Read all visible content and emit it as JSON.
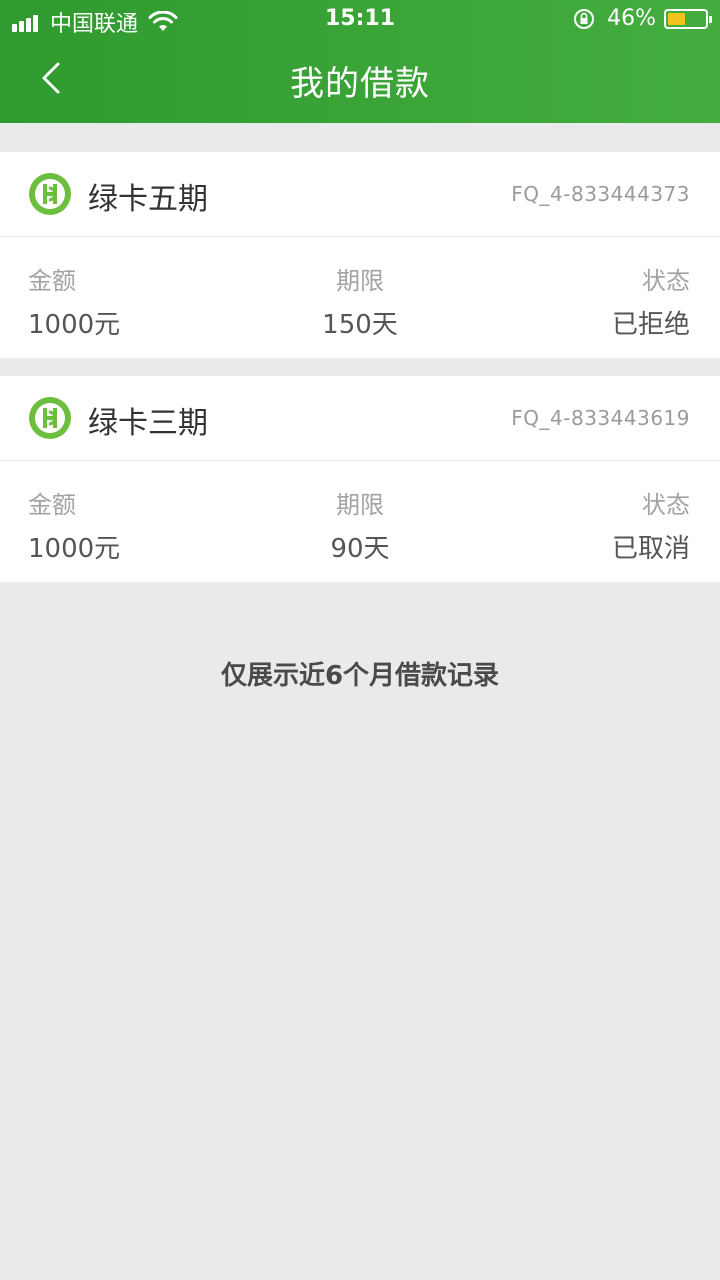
{
  "status_bar": {
    "carrier": "中国联通",
    "time": "15:11",
    "battery_percent": "46%",
    "battery_level": 0.46,
    "battery_color": "#f4c21b"
  },
  "nav": {
    "back_icon": "chevron-left-icon",
    "title": "我的借款"
  },
  "theme": {
    "primary": "#3aa53a",
    "background": "#e9eaec"
  },
  "loans": [
    {
      "product": "绿卡五期",
      "order_no": "FQ_4-833444373",
      "amount_label": "金额",
      "amount": "1000元",
      "term_label": "期限",
      "term": "150天",
      "status_label": "状态",
      "status": "已拒绝"
    },
    {
      "product": "绿卡三期",
      "order_no": "FQ_4-833443619",
      "amount_label": "金额",
      "amount": "1000元",
      "term_label": "期限",
      "term": "90天",
      "status_label": "状态",
      "status": "已取消"
    }
  ],
  "footnote": "仅展示近6个月借款记录"
}
